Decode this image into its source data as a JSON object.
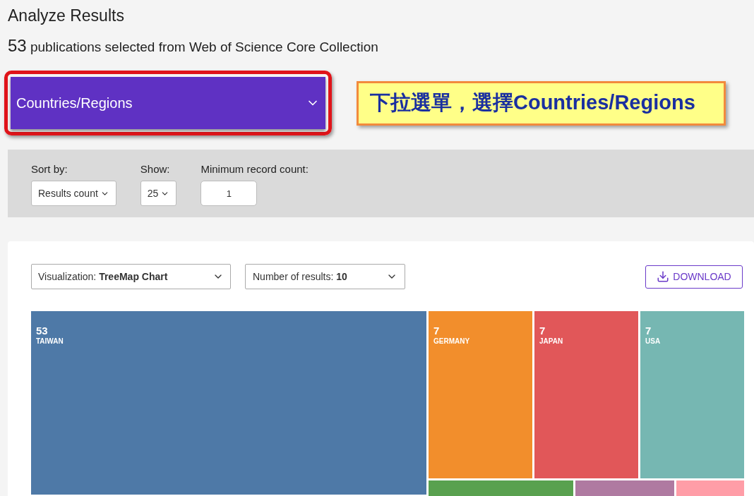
{
  "page": {
    "title": "Analyze Results",
    "count": "53",
    "subtitle": "publications selected from Web of Science Core Collection"
  },
  "field_dropdown": {
    "value": "Countries/Regions"
  },
  "annotation": {
    "text": "下拉選單，選擇Countries/Regions"
  },
  "filters": {
    "sort_by": {
      "label": "Sort by:",
      "value": "Results count"
    },
    "show": {
      "label": "Show:",
      "value": "25"
    },
    "minimum": {
      "label": "Minimum record count:",
      "value": "1"
    }
  },
  "visualization": {
    "label": "Visualization:",
    "value": "TreeMap Chart"
  },
  "number_of_results": {
    "label": "Number of results:",
    "value": "10"
  },
  "download_button": "DOWNLOAD",
  "treemap": {
    "main": {
      "value": "53",
      "label": "TAIWAN",
      "color": "#4e79a7"
    },
    "top_row": [
      {
        "value": "7",
        "label": "GERMANY",
        "color": "#f28e2c"
      },
      {
        "value": "7",
        "label": "JAPAN",
        "color": "#e15759"
      },
      {
        "value": "7",
        "label": "USA",
        "color": "#76b7b2"
      }
    ],
    "bottom_row": [
      {
        "color": "#59a14f"
      },
      {
        "color": "#af7aa1"
      },
      {
        "color": "#ff9da7"
      }
    ]
  }
}
